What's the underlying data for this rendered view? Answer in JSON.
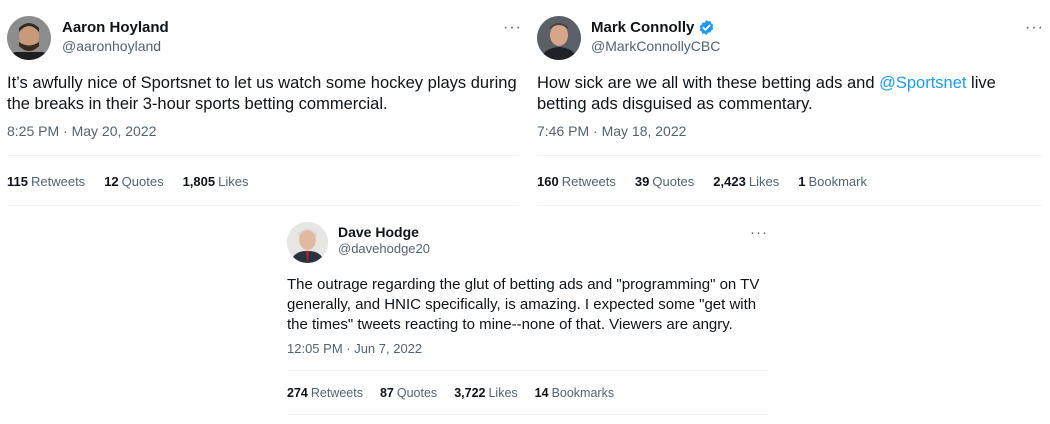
{
  "tweets": [
    {
      "name": "Aaron Hoyland",
      "handle": "@aaronhoyland",
      "verified": false,
      "more_icon": "more-horizontal-icon",
      "text": "It’s awfully nice of Sportsnet to let us watch some hockey plays during the breaks in their 3-hour sports betting commercial.",
      "timestamp": "8:25 PM · May 20, 2022",
      "stats": {
        "retweets_count": "115",
        "retweets_label": "Retweets",
        "quotes_count": "12",
        "quotes_label": "Quotes",
        "likes_count": "1,805",
        "likes_label": "Likes"
      }
    },
    {
      "name": "Mark Connolly",
      "handle": "@MarkConnollyCBC",
      "verified": true,
      "more_icon": "more-horizontal-icon",
      "text_before": "How sick are we all with these betting ads and ",
      "mention": "@Sportsnet",
      "text_after": " live betting ads disguised as commentary.",
      "timestamp": "7:46 PM · May 18, 2022",
      "stats": {
        "retweets_count": "160",
        "retweets_label": "Retweets",
        "quotes_count": "39",
        "quotes_label": "Quotes",
        "likes_count": "2,423",
        "likes_label": "Likes",
        "bookmarks_count": "1",
        "bookmarks_label": "Bookmark"
      }
    },
    {
      "name": "Dave Hodge",
      "handle": "@davehodge20",
      "verified": false,
      "more_icon": "more-horizontal-icon",
      "text": "The outrage regarding the glut of betting ads and \"programming\" on TV generally, and HNIC specifically, is amazing. I expected some \"get with the times\" tweets reacting to mine--none of that. Viewers are angry.",
      "timestamp": "12:05 PM · Jun 7, 2022",
      "stats": {
        "retweets_count": "274",
        "retweets_label": "Retweets",
        "quotes_count": "87",
        "quotes_label": "Quotes",
        "likes_count": "3,722",
        "likes_label": "Likes",
        "bookmarks_count": "14",
        "bookmarks_label": "Bookmarks"
      }
    }
  ],
  "colors": {
    "text_primary": "#0f1419",
    "text_secondary": "#536471",
    "link": "#1d9bf0",
    "divider": "#eff3f4",
    "verified_badge": "#1d9bf0"
  }
}
